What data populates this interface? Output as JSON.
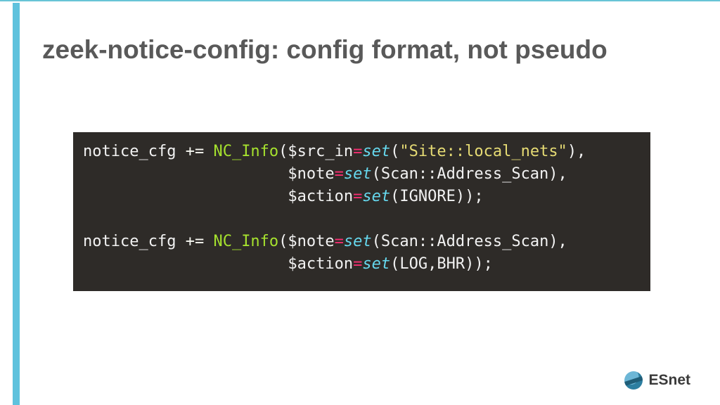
{
  "title": "zeek-notice-config:   config format, not pseudo",
  "code": {
    "l1a": "notice_cfg ",
    "l1b": "+=",
    "l1c": " ",
    "l1d": "NC_Info",
    "l1e": "($src_in",
    "l1f": "=",
    "l1g": "set",
    "l1h": "(",
    "l1i": "\"Site::local_nets\"",
    "l1j": "),",
    "indent2": "                      ",
    "l2a": "$note",
    "l2b": "=",
    "l2c": "set",
    "l2d": "(Scan::Address_Scan),",
    "l3a": "$action",
    "l3b": "=",
    "l3c": "set",
    "l3d": "(IGNORE));",
    "l4a": "notice_cfg ",
    "l4b": "+=",
    "l4c": " ",
    "l4d": "NC_Info",
    "l4e": "($note",
    "l4f": "=",
    "l4g": "set",
    "l4h": "(Scan::Address_Scan),",
    "l5a": "$action",
    "l5b": "=",
    "l5c": "set",
    "l5d": "(LOG,BHR));"
  },
  "brand": "ESnet"
}
